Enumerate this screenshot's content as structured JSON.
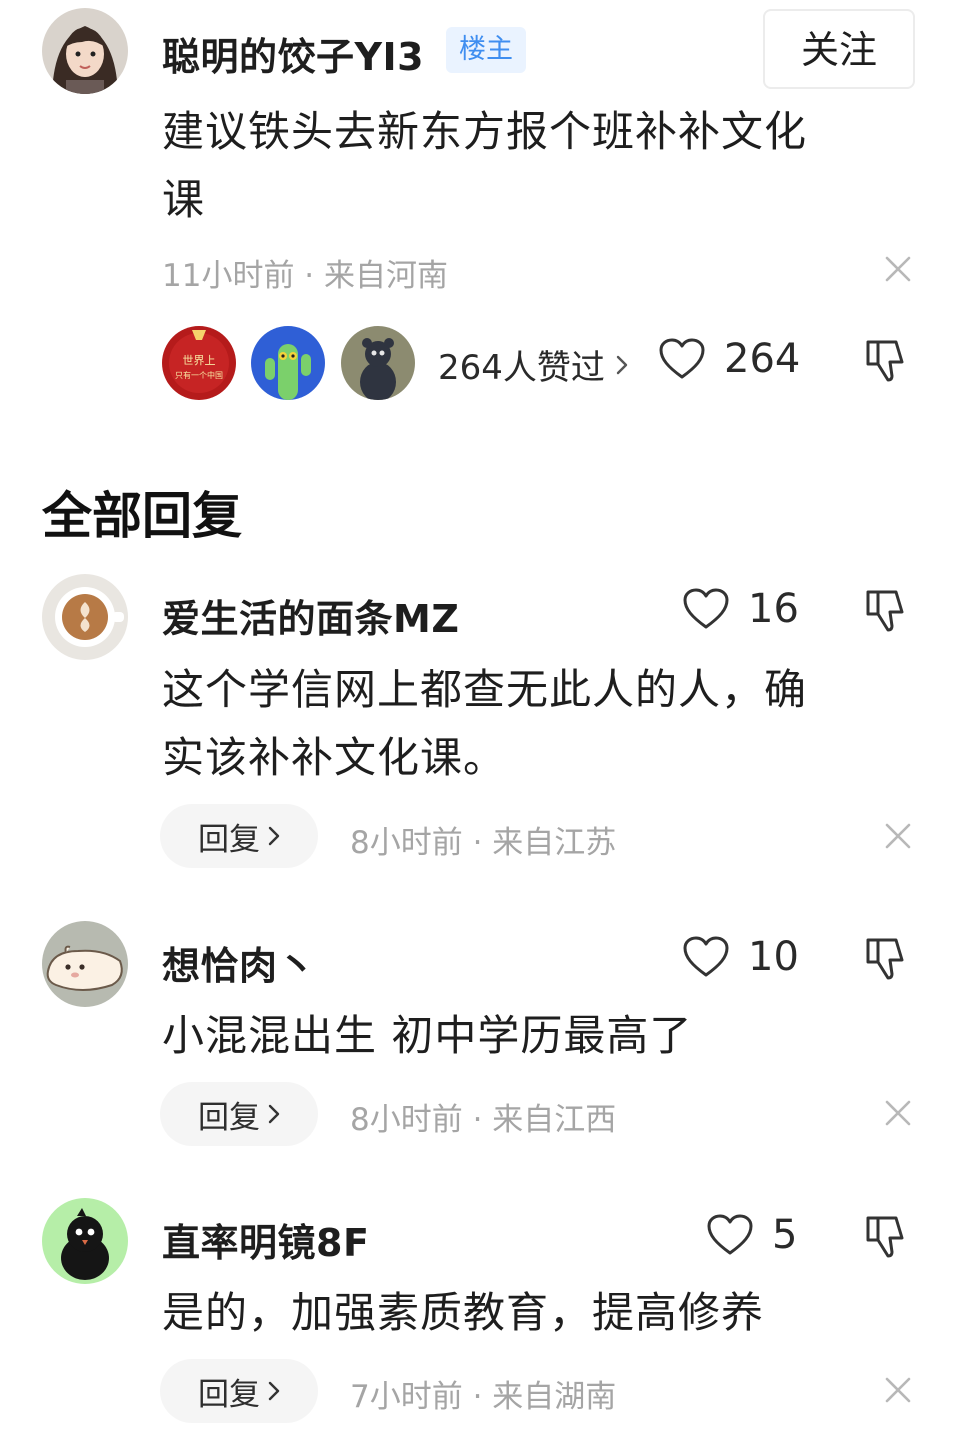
{
  "main_comment": {
    "username": "聪明的饺子YI3",
    "badge": "楼主",
    "follow_label": "关注",
    "text_line1": "建议铁头去新东方报个班补补文化",
    "text_line2": "课",
    "meta": "11小时前 · 来自河南",
    "liker_avatar_text_1": "世界上",
    "liker_avatar_text_2": "只有一个中国",
    "likers_label": "264人赞过",
    "like_count": "264"
  },
  "section_title": "全部回复",
  "replies": [
    {
      "username": "爱生活的面条MZ",
      "like_count": "16",
      "text_line1": "这个学信网上都查无此人的人，确",
      "text_line2": "实该补补文化课。",
      "reply_label": "回复",
      "meta": "8小时前 · 来自江苏"
    },
    {
      "username": "想恰肉丶",
      "like_count": "10",
      "text_line1": "小混混出生 初中学历最高了",
      "reply_label": "回复",
      "meta": "8小时前 · 来自江西"
    },
    {
      "username": "直率明镜8F",
      "like_count": "5",
      "text_line1": "是的，加强素质教育，提高修养",
      "reply_label": "回复",
      "meta": "7小时前 · 来自湖南"
    }
  ],
  "icons": {
    "heart": "heart-icon",
    "dislike": "thumbs-down-icon",
    "close": "close-icon",
    "chevron": "chevron-right-icon"
  },
  "colors": {
    "badge_text": "#3f8ef0",
    "badge_bg": "#eaf3ff",
    "meta_text": "#a5a5a5",
    "reply_bg": "#f5f5f5"
  }
}
